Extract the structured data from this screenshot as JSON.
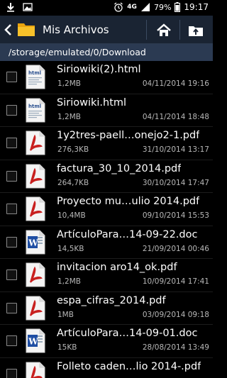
{
  "status_bar": {
    "network": "4G",
    "battery": "79%",
    "time": "19:17"
  },
  "header": {
    "title": "Mis Archivos"
  },
  "path": "/storage/emulated/0/Download",
  "files": [
    {
      "name": "Siriowiki(2).html",
      "size": "1,2MB",
      "date": "04/11/2014 19:16",
      "type": "html"
    },
    {
      "name": "Siriowiki.html",
      "size": "1,2MB",
      "date": "04/11/2014 18:48",
      "type": "html"
    },
    {
      "name": "1y2tres-paell…onejo2-1.pdf",
      "size": "276,3KB",
      "date": "31/10/2014 13:17",
      "type": "pdf"
    },
    {
      "name": "factura_30_10_2014.pdf",
      "size": "264,7KB",
      "date": "30/10/2014 17:47",
      "type": "pdf"
    },
    {
      "name": "Proyecto mu…ulio 2014.pdf",
      "size": "10,4MB",
      "date": "09/10/2014 15:53",
      "type": "pdf"
    },
    {
      "name": "ArtículoPara…14-09-22.doc",
      "size": "14,5KB",
      "date": "21/09/2014 00:46",
      "type": "doc"
    },
    {
      "name": "invitacion aro14_ok.pdf",
      "size": "1,2MB",
      "date": "10/09/2014 17:41",
      "type": "pdf"
    },
    {
      "name": "espa_cifras_2014.pdf",
      "size": "1MB",
      "date": "03/09/2014 09:18",
      "type": "pdf"
    },
    {
      "name": "ArtículoPara…14-09-01.doc",
      "size": "15KB",
      "date": "28/08/2014 13:49",
      "type": "doc"
    },
    {
      "name": "Folleto caden…lio 2014-.pdf",
      "size": "",
      "date": "",
      "type": "pdf"
    }
  ],
  "icons": {
    "back": "chevron-left-icon",
    "folder": "folder-icon",
    "home": "home-icon",
    "up": "folder-up-icon",
    "html": "html-file-icon",
    "pdf": "pdf-file-icon",
    "doc": "word-file-icon"
  },
  "colors": {
    "action_bar": "#1a2433",
    "path_bar": "#2b3a52",
    "background": "#000000",
    "folder": "#f3b21b",
    "pdf_red": "#c8201f",
    "word_blue": "#1f4ea3"
  }
}
